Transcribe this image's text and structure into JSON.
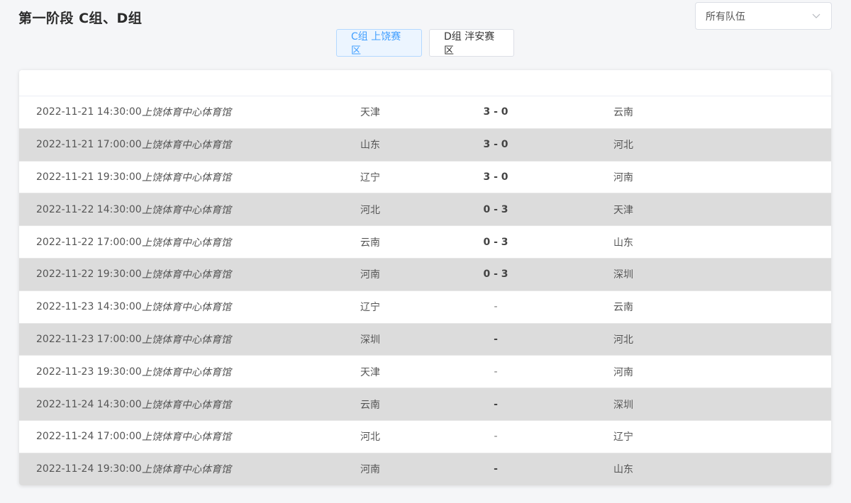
{
  "header": {
    "title": "第一阶段 C组、D组"
  },
  "filter": {
    "selected": "所有队伍",
    "icon": "chevron-down-icon"
  },
  "tabs": [
    {
      "label": "C组 上饶赛区",
      "active": true
    },
    {
      "label": "D组 泮安赛区",
      "active": false
    }
  ],
  "colors": {
    "accent": "#409eff",
    "row_alt": "#dcdcdc"
  },
  "matches": [
    {
      "time": "2022-11-21 14:30:00",
      "venue": "上饶体育中心体育馆",
      "home": "天津",
      "score": "3 - 0",
      "away": "云南"
    },
    {
      "time": "2022-11-21 17:00:00",
      "venue": "上饶体育中心体育馆",
      "home": "山东",
      "score": "3 - 0",
      "away": "河北"
    },
    {
      "time": "2022-11-21 19:30:00",
      "venue": "上饶体育中心体育馆",
      "home": "辽宁",
      "score": "3 - 0",
      "away": "河南"
    },
    {
      "time": "2022-11-22 14:30:00",
      "venue": "上饶体育中心体育馆",
      "home": "河北",
      "score": "0 - 3",
      "away": "天津"
    },
    {
      "time": "2022-11-22 17:00:00",
      "venue": "上饶体育中心体育馆",
      "home": "云南",
      "score": "0 - 3",
      "away": "山东"
    },
    {
      "time": "2022-11-22 19:30:00",
      "venue": "上饶体育中心体育馆",
      "home": "河南",
      "score": "0 - 3",
      "away": "深圳"
    },
    {
      "time": "2022-11-23 14:30:00",
      "venue": "上饶体育中心体育馆",
      "home": "辽宁",
      "score": "-",
      "away": "云南"
    },
    {
      "time": "2022-11-23 17:00:00",
      "venue": "上饶体育中心体育馆",
      "home": "深圳",
      "score": "-",
      "away": "河北"
    },
    {
      "time": "2022-11-23 19:30:00",
      "venue": "上饶体育中心体育馆",
      "home": "天津",
      "score": "-",
      "away": "河南"
    },
    {
      "time": "2022-11-24 14:30:00",
      "venue": "上饶体育中心体育馆",
      "home": "云南",
      "score": "-",
      "away": "深圳"
    },
    {
      "time": "2022-11-24 17:00:00",
      "venue": "上饶体育中心体育馆",
      "home": "河北",
      "score": "-",
      "away": "辽宁"
    },
    {
      "time": "2022-11-24 19:30:00",
      "venue": "上饶体育中心体育馆",
      "home": "河南",
      "score": "-",
      "away": "山东"
    }
  ]
}
